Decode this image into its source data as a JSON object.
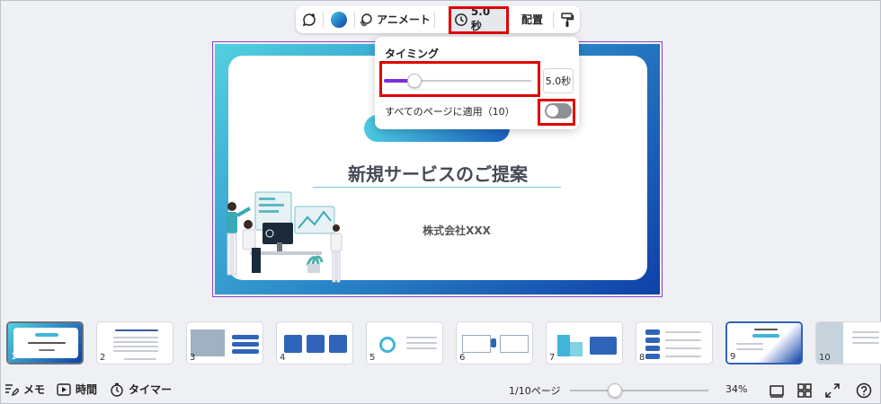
{
  "toolbar": {
    "animate_label": "アニメート",
    "time_label": "5.0秒",
    "arrange_label": "配置",
    "color_value": "#1e73c8"
  },
  "timing_popover": {
    "title": "タイミング",
    "slider_value_seconds": 5.0,
    "slider_fraction": 0.2,
    "value_text": "5.0秒",
    "apply_all_label": "すべてのページに適用（10）",
    "apply_all_enabled": false
  },
  "slide": {
    "title": "新規サービスのご提案",
    "company": "株式会社XXX"
  },
  "thumbnails": [
    {
      "num": "1",
      "selected": true
    },
    {
      "num": "2",
      "selected": false
    },
    {
      "num": "3",
      "selected": false
    },
    {
      "num": "4",
      "selected": false
    },
    {
      "num": "5",
      "selected": false
    },
    {
      "num": "6",
      "selected": false
    },
    {
      "num": "7",
      "selected": false
    },
    {
      "num": "8",
      "selected": false
    },
    {
      "num": "9",
      "selected": false
    },
    {
      "num": "10",
      "selected": false
    }
  ],
  "bottom_bar": {
    "memo_label": "メモ",
    "time_label": "時間",
    "timer_label": "タイマー",
    "page_indicator": "1/10ページ",
    "zoom_fraction": 0.32,
    "zoom_text": "34%"
  },
  "colors": {
    "accent": "#7a2de0",
    "highlight": "#e00000"
  }
}
